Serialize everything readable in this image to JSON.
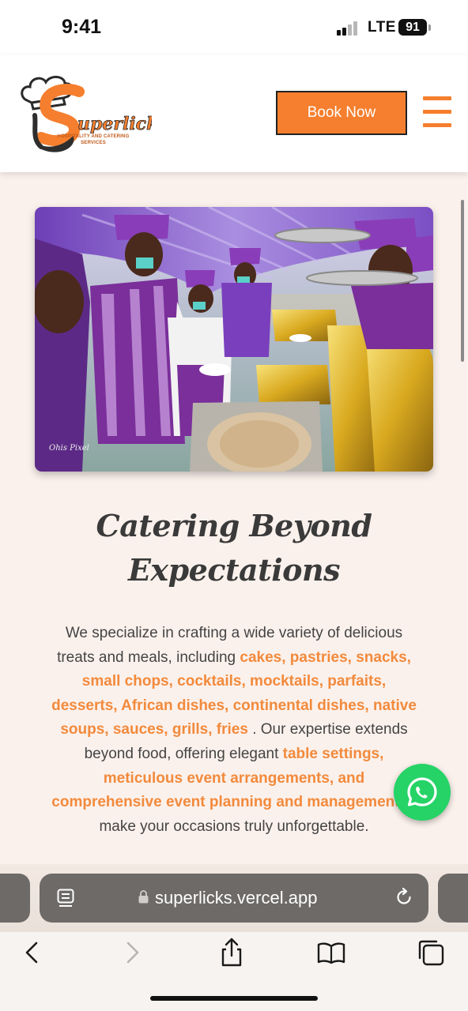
{
  "status_bar": {
    "time": "9:41",
    "network": "LTE",
    "battery": "91"
  },
  "header": {
    "logo_alt": "Superlicks Hospitality and Catering Services",
    "logo_subtitle": "HOSPITALITY AND CATERING SERVICES",
    "book_button": "Book Now",
    "menu_icon": "hamburger-menu-icon"
  },
  "hero": {
    "image_description": "Caterers in purple uniforms serving food at an event buffet",
    "watermark": "Ohis Pixel"
  },
  "main": {
    "heading_line1": "Catering Beyond",
    "heading_line2": "Expectations",
    "desc_intro": "We specialize in crafting a wide variety of delicious treats and meals, including ",
    "desc_foods": "cakes, pastries, snacks, small chops, cocktails, mocktails, parfaits, desserts, African dishes, continental dishes, native soups, sauces, grills, fries",
    "desc_mid": " . Our expertise extends beyond food, offering elegant ",
    "desc_services": "table settings, meticulous event arrangements, and comprehensive event planning and management",
    "desc_end": " to make your occasions truly unforgettable."
  },
  "floating": {
    "whatsapp_icon": "whatsapp-icon"
  },
  "browser": {
    "url": "superlicks.vercel.app",
    "icons": [
      "reader-icon",
      "lock-icon",
      "reload-icon",
      "back-icon",
      "forward-icon",
      "share-icon",
      "bookmarks-icon",
      "tabs-icon"
    ]
  },
  "colors": {
    "accent": "#f57f2e",
    "highlight_text": "#f28a3c",
    "whatsapp": "#25d366",
    "page_bg": "#fbf1ec"
  }
}
